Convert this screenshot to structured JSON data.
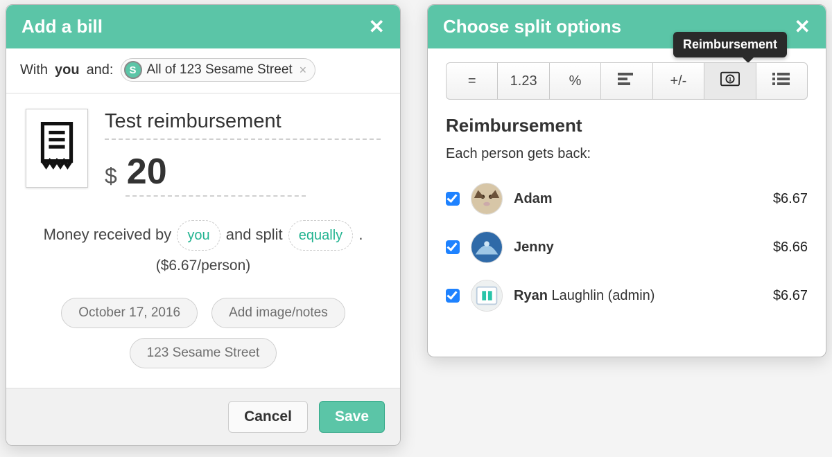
{
  "add": {
    "title": "Add a bill",
    "with_prefix": "With",
    "with_you": "you",
    "with_suffix": "and:",
    "group_chip": "All of 123 Sesame Street",
    "description": "Test reimbursement",
    "currency": "$",
    "amount": "20",
    "sentence": {
      "a": "Money received by",
      "payer": "you",
      "b": "and split",
      "method": "equally",
      "c": "."
    },
    "per_person": "($6.67/person)",
    "date": "October 17, 2016",
    "notes_label": "Add image/notes",
    "group_button": "123 Sesame Street",
    "cancel": "Cancel",
    "save": "Save"
  },
  "split": {
    "title": "Choose split options",
    "tooltip": "Reimbursement",
    "tabs": [
      "=",
      "1.23",
      "%",
      "shares",
      "+/-",
      "reimbursement",
      "itemized"
    ],
    "heading": "Reimbursement",
    "subheading": "Each person gets back:",
    "people": [
      {
        "first": "Adam",
        "rest": "",
        "amount": "$6.67",
        "checked": true
      },
      {
        "first": "Jenny",
        "rest": "",
        "amount": "$6.66",
        "checked": true
      },
      {
        "first": "Ryan",
        "rest": "Laughlin (admin)",
        "amount": "$6.67",
        "checked": true
      }
    ]
  }
}
